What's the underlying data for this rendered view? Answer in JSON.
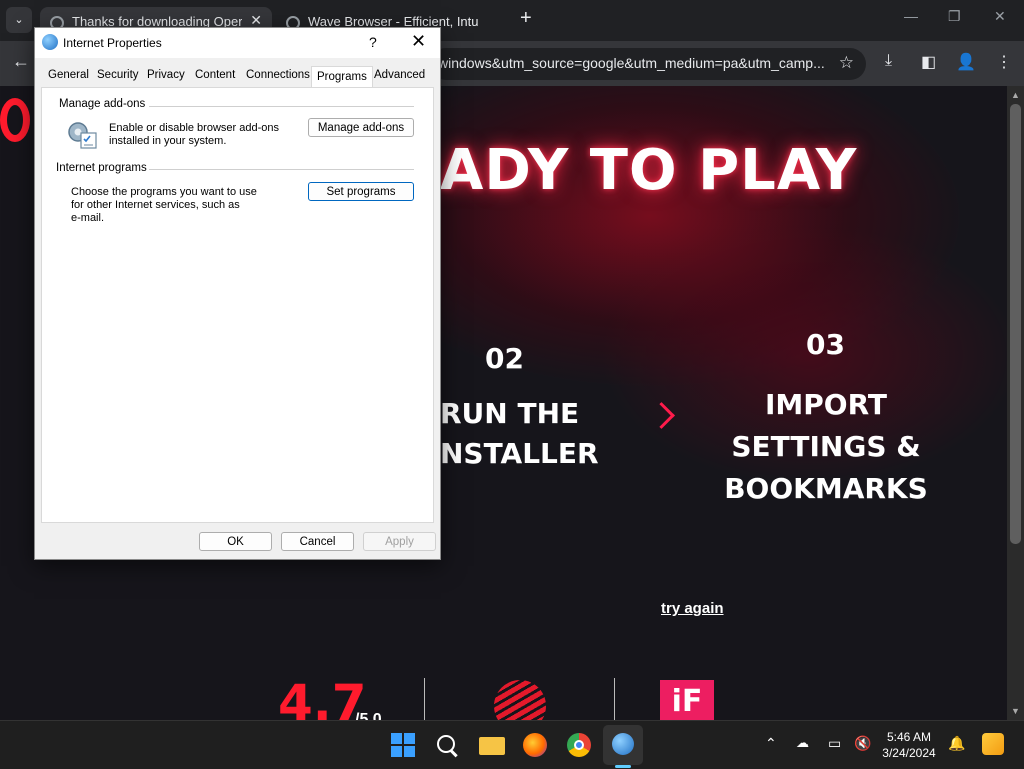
{
  "browser": {
    "tabs": [
      {
        "title": "Thanks for downloading Opera",
        "close": "✕"
      },
      {
        "title": "Wave Browser - Efficient, Intuiti",
        "close": "✕"
      }
    ],
    "tab_search_icon": "⌄",
    "new_tab": "+",
    "window_controls": {
      "minimize": "—",
      "maximize": "❐",
      "close": "✕"
    },
    "back": "←",
    "url": "windows&utm_source=google&utm_medium=pa&utm_camp...",
    "bookmark_star": "☆",
    "download_icon": "⤓",
    "sidepanel_icon": "◧",
    "profile_icon": "👤",
    "menu_icon": "⋮"
  },
  "page": {
    "hero": "ADY TO PLAY",
    "step2_num": "02",
    "step2_line1": "RUN THE",
    "step2_line2": "NSTALLER",
    "step3_num": "03",
    "step3_line1": "IMPORT",
    "step3_line2": "SETTINGS &",
    "step3_line3": "BOOKMARKS",
    "try_again": "try again",
    "rating": "4.7",
    "rating_sub": "/5.0",
    "if_logo": "iF"
  },
  "dialog": {
    "title": "Internet Properties",
    "help": "?",
    "close": "✕",
    "tabs": [
      "General",
      "Security",
      "Privacy",
      "Content",
      "Connections",
      "Programs",
      "Advanced"
    ],
    "active_tab": "Programs",
    "addons_group": "Manage add-ons",
    "addons_desc_1": "Enable or disable browser add-ons",
    "addons_desc_2": "installed in your system.",
    "addons_button": "Manage add-ons",
    "programs_group": "Internet programs",
    "programs_desc_1": "Choose the programs you want to use",
    "programs_desc_2": "for other Internet services, such as",
    "programs_desc_3": "e-mail.",
    "programs_button": "Set programs",
    "ok": "OK",
    "cancel": "Cancel",
    "apply": "Apply"
  },
  "taskbar": {
    "clock_time": "5:46 AM",
    "clock_date": "3/24/2024",
    "tray_chevron": "⌃",
    "notification": "🔔"
  }
}
